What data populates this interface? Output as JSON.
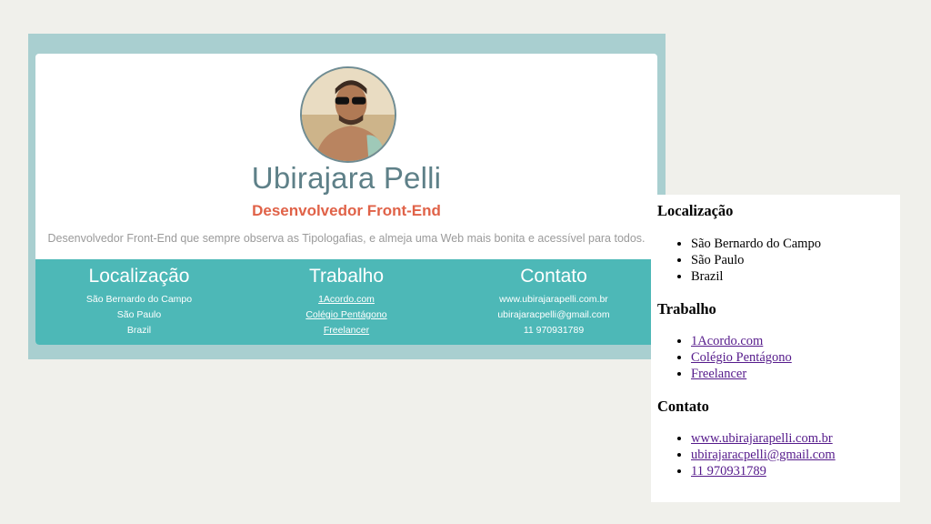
{
  "profile": {
    "name": "Ubirajara Pelli",
    "role": "Desenvolvedor Front-End",
    "bio": "Desenvolvedor Front-End que sempre observa as Tipologafias, e almeja uma Web mais bonita e acessível para todos."
  },
  "sections": {
    "location": {
      "title": "Localização",
      "items": [
        "São Bernardo do Campo",
        "São Paulo",
        "Brazil"
      ]
    },
    "work": {
      "title": "Trabalho",
      "items": [
        "1Acordo.com",
        "Colégio Pentágono",
        "Freelancer"
      ]
    },
    "contact": {
      "title": "Contato",
      "items": [
        "www.ubirajarapelli.com.br",
        "ubirajaracpelli@gmail.com",
        "11 970931789"
      ]
    }
  },
  "colors": {
    "frame": "#a9cfd0",
    "teal_band": "#4db8b7",
    "name": "#5e8088",
    "role": "#e06248",
    "visited_link": "#551a8b"
  }
}
